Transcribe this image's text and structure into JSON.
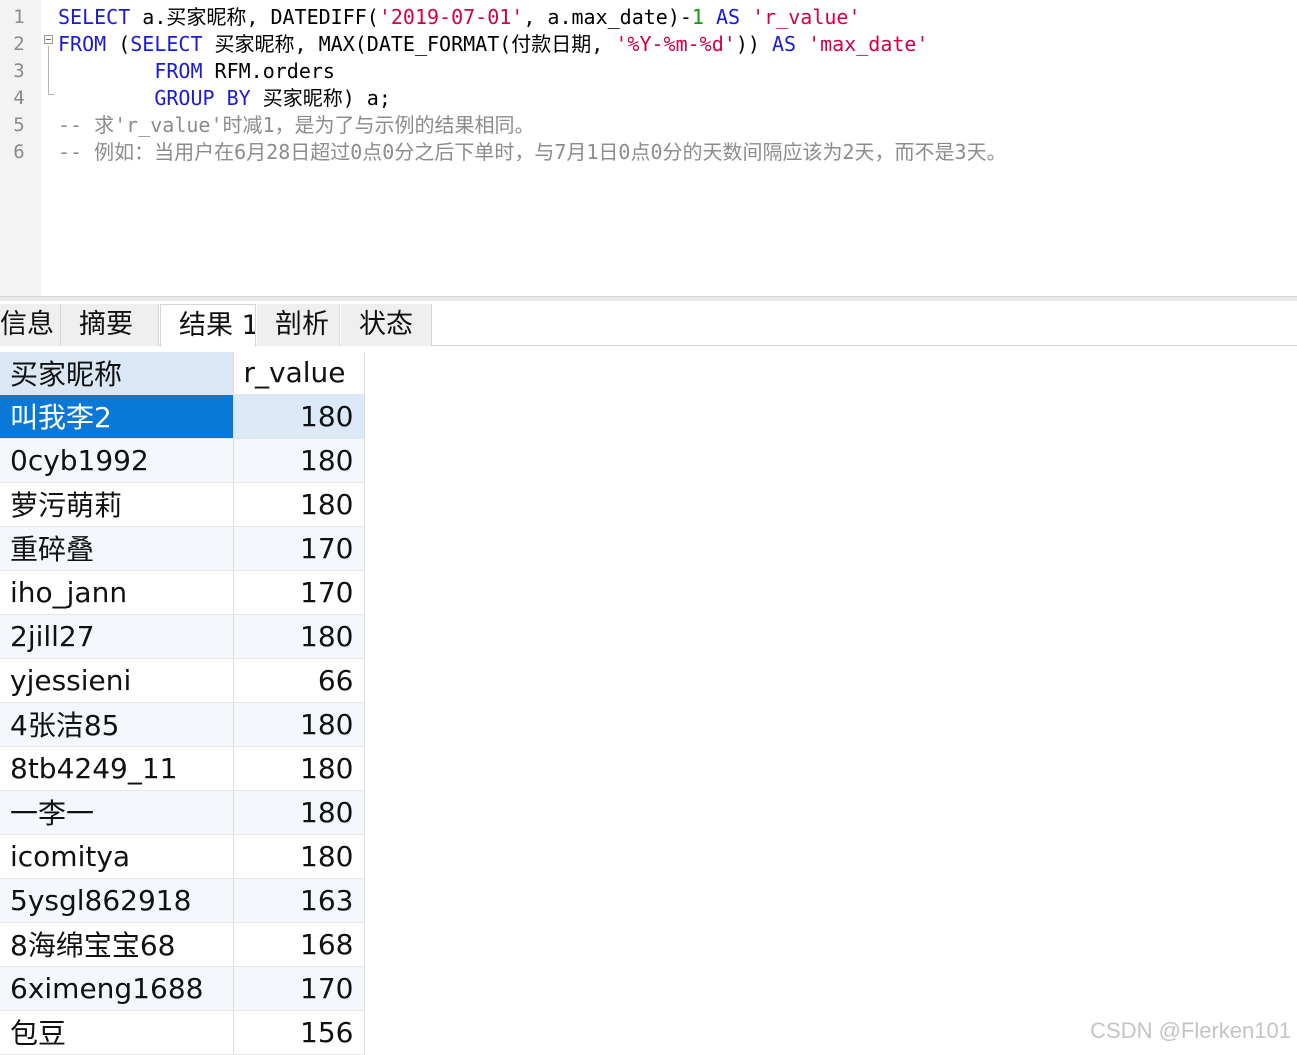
{
  "editor": {
    "lines": [
      {
        "n": "1",
        "tokens": [
          {
            "t": "SELECT",
            "c": "kw"
          },
          {
            "t": " a.买家昵称, DATEDIFF(",
            "c": "tx"
          },
          {
            "t": "'2019-07-01'",
            "c": "str"
          },
          {
            "t": ", a.max_date)-",
            "c": "tx"
          },
          {
            "t": "1",
            "c": "num"
          },
          {
            "t": " ",
            "c": "tx"
          },
          {
            "t": "AS",
            "c": "kw"
          },
          {
            "t": " ",
            "c": "tx"
          },
          {
            "t": "'r_value'",
            "c": "str"
          }
        ]
      },
      {
        "n": "2",
        "tokens": [
          {
            "t": "FROM",
            "c": "kw"
          },
          {
            "t": " (",
            "c": "tx"
          },
          {
            "t": "SELECT",
            "c": "kw"
          },
          {
            "t": " 买家昵称, MAX(DATE_FORMAT(付款日期, ",
            "c": "tx"
          },
          {
            "t": "'%Y-%m-%d'",
            "c": "str"
          },
          {
            "t": ")) ",
            "c": "tx"
          },
          {
            "t": "AS",
            "c": "kw"
          },
          {
            "t": " ",
            "c": "tx"
          },
          {
            "t": "'max_date'",
            "c": "str"
          }
        ]
      },
      {
        "n": "3",
        "tokens": [
          {
            "t": "        ",
            "c": "tx"
          },
          {
            "t": "FROM",
            "c": "kw"
          },
          {
            "t": " RFM.orders",
            "c": "tx"
          }
        ]
      },
      {
        "n": "4",
        "tokens": [
          {
            "t": "        ",
            "c": "tx"
          },
          {
            "t": "GROUP BY",
            "c": "kw"
          },
          {
            "t": " 买家昵称) a;",
            "c": "tx"
          }
        ]
      },
      {
        "n": "5",
        "tokens": [
          {
            "t": "-- 求'r_value'时减1，是为了与示例的结果相同。",
            "c": "cmt"
          }
        ]
      },
      {
        "n": "6",
        "tokens": [
          {
            "t": "-- 例如：当用户在6月28日超过0点0分之后下单时，与7月1日0点0分的天数间隔应该为2天，而不是3天。",
            "c": "cmt"
          }
        ]
      }
    ]
  },
  "tabs": [
    {
      "label": "信息",
      "active": false
    },
    {
      "label": "摘要",
      "active": false
    },
    {
      "label": "结果 1",
      "active": true
    },
    {
      "label": "剖析",
      "active": false
    },
    {
      "label": "状态",
      "active": false
    }
  ],
  "grid": {
    "columns": [
      "买家昵称",
      "r_value"
    ],
    "rows": [
      {
        "name": "叫我李2",
        "value": "180"
      },
      {
        "name": "0cyb1992",
        "value": "180"
      },
      {
        "name": "萝污萌莉",
        "value": "180"
      },
      {
        "name": "重碎叠",
        "value": "170"
      },
      {
        "name": "iho_jann",
        "value": "170"
      },
      {
        "name": "2jill27",
        "value": "180"
      },
      {
        "name": "yjessieni",
        "value": "66"
      },
      {
        "name": "4张洁85",
        "value": "180"
      },
      {
        "name": "8tb4249_11",
        "value": "180"
      },
      {
        "name": "一李一",
        "value": "180"
      },
      {
        "name": "icomitya",
        "value": "180"
      },
      {
        "name": "5ysgl862918",
        "value": "163"
      },
      {
        "name": "8海绵宝宝68",
        "value": "168"
      },
      {
        "name": "6ximeng1688",
        "value": "170"
      },
      {
        "name": "包豆",
        "value": "156"
      }
    ],
    "selected_row": 0
  },
  "watermark": "CSDN @Flerken101",
  "colors": {
    "keyword": "#1a1ad6",
    "string": "#d0004a",
    "number": "#0a9a0a",
    "comment": "#8c8c8c",
    "selection": "#0a78d7",
    "header_highlight": "#dbe7f5"
  }
}
